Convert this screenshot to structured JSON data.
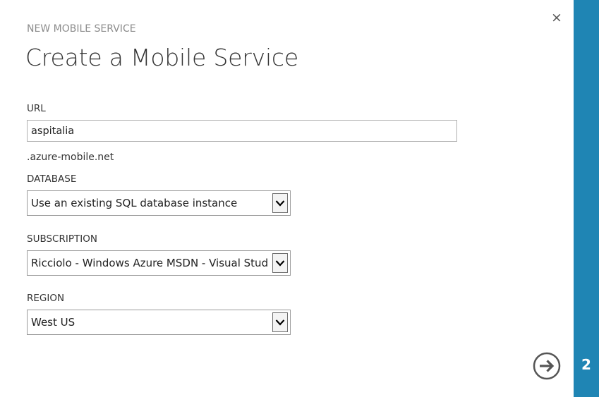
{
  "dialog": {
    "subtitle": "NEW MOBILE SERVICE",
    "title": "Create a Mobile Service",
    "close_symbol": "×"
  },
  "form": {
    "url": {
      "label": "URL",
      "value": "aspitalia",
      "suffix": ".azure-mobile.net"
    },
    "database": {
      "label": "DATABASE",
      "selected": "Use an existing SQL database instance"
    },
    "subscription": {
      "label": "SUBSCRIPTION",
      "selected": "Ricciolo - Windows Azure MSDN - Visual Studio"
    },
    "region": {
      "label": "REGION",
      "selected": "West US"
    }
  },
  "wizard": {
    "step": "2",
    "accent_color": "#1f85b4"
  },
  "icons": {
    "close": "close-icon",
    "next": "arrow-right-circle-icon",
    "dropdown": "chevron-down-icon"
  }
}
